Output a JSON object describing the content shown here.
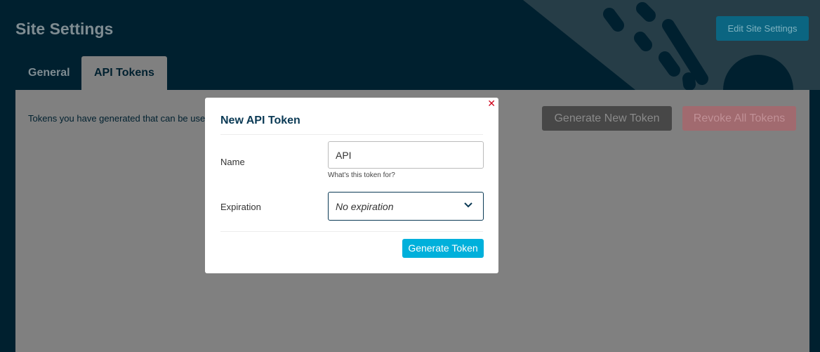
{
  "header": {
    "title": "Site Settings",
    "edit_button": "Edit Site Settings"
  },
  "tabs": [
    {
      "label": "General"
    },
    {
      "label": "API Tokens",
      "active": true
    }
  ],
  "panel": {
    "description": "Tokens you have generated that can be used",
    "generate_new_button": "Generate New Token",
    "revoke_all_button": "Revoke All Tokens"
  },
  "modal": {
    "title": "New API Token",
    "close_icon": "close-x",
    "name_label": "Name",
    "name_value": "API",
    "name_hint": "What's this token for?",
    "expiration_label": "Expiration",
    "expiration_value": "No expiration",
    "submit_button": "Generate Token"
  },
  "colors": {
    "accent": "#00b0db",
    "close": "#d0021b",
    "title": "#0b3a55"
  }
}
